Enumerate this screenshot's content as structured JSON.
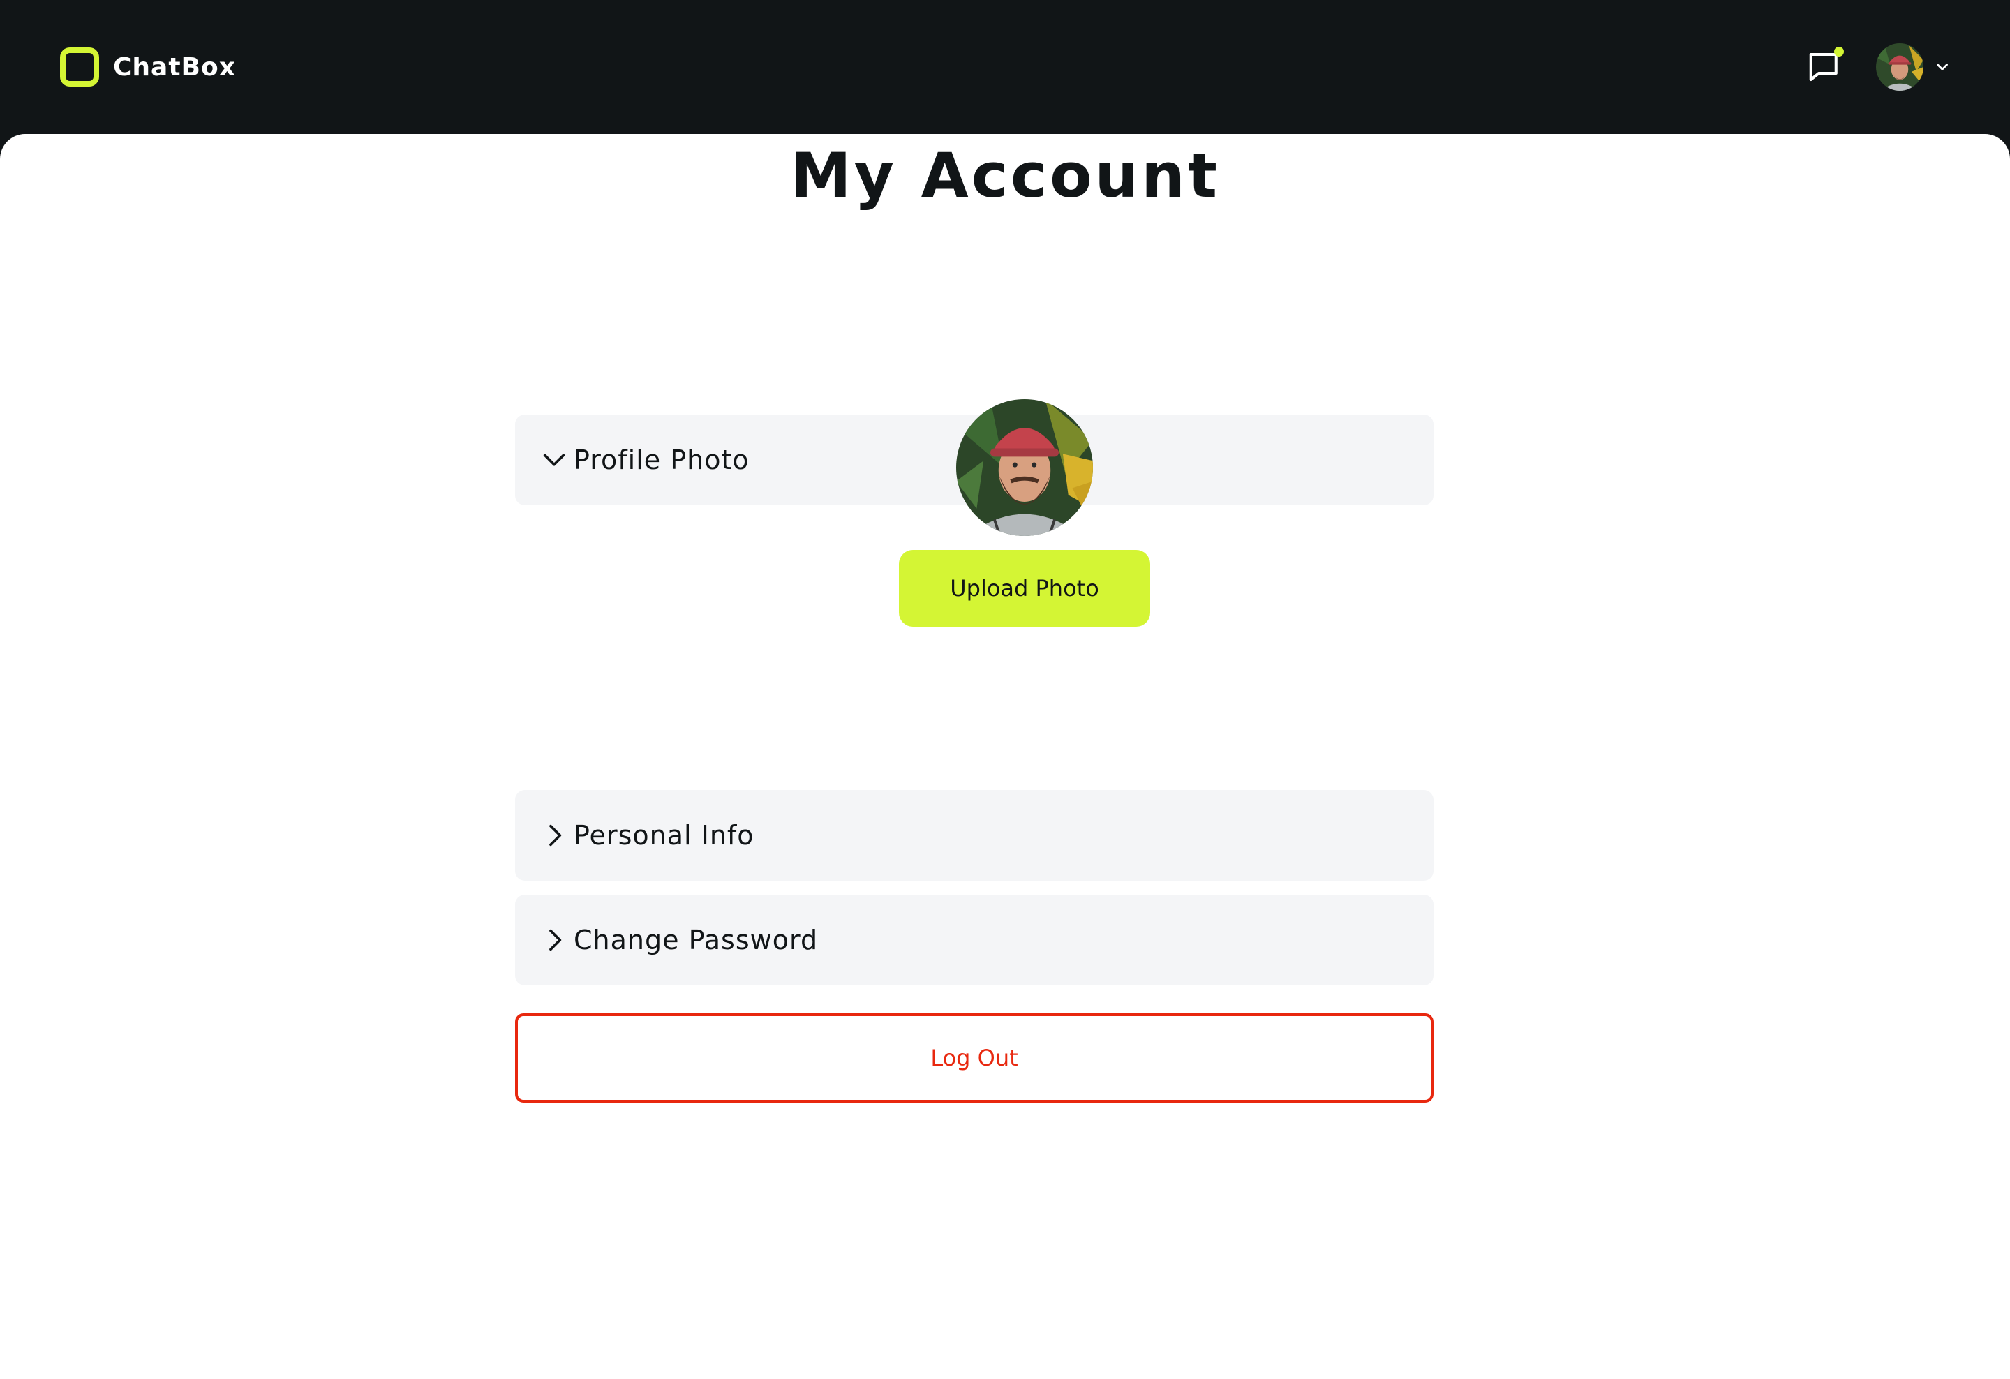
{
  "app": {
    "name": "ChatBox",
    "accent_color": "#d4f534",
    "danger_color": "#e8280f"
  },
  "header": {
    "chat_icon": "chat-bubble-icon",
    "has_notification": true
  },
  "page": {
    "title": "My Account"
  },
  "sections": [
    {
      "label": "Profile Photo",
      "expanded": true,
      "icon": "chevron-down-icon"
    },
    {
      "label": "Personal Info",
      "expanded": false,
      "icon": "chevron-right-icon"
    },
    {
      "label": "Change Password",
      "expanded": false,
      "icon": "chevron-right-icon"
    }
  ],
  "profile_photo": {
    "upload_label": "Upload Photo"
  },
  "actions": {
    "logout_label": "Log Out"
  }
}
